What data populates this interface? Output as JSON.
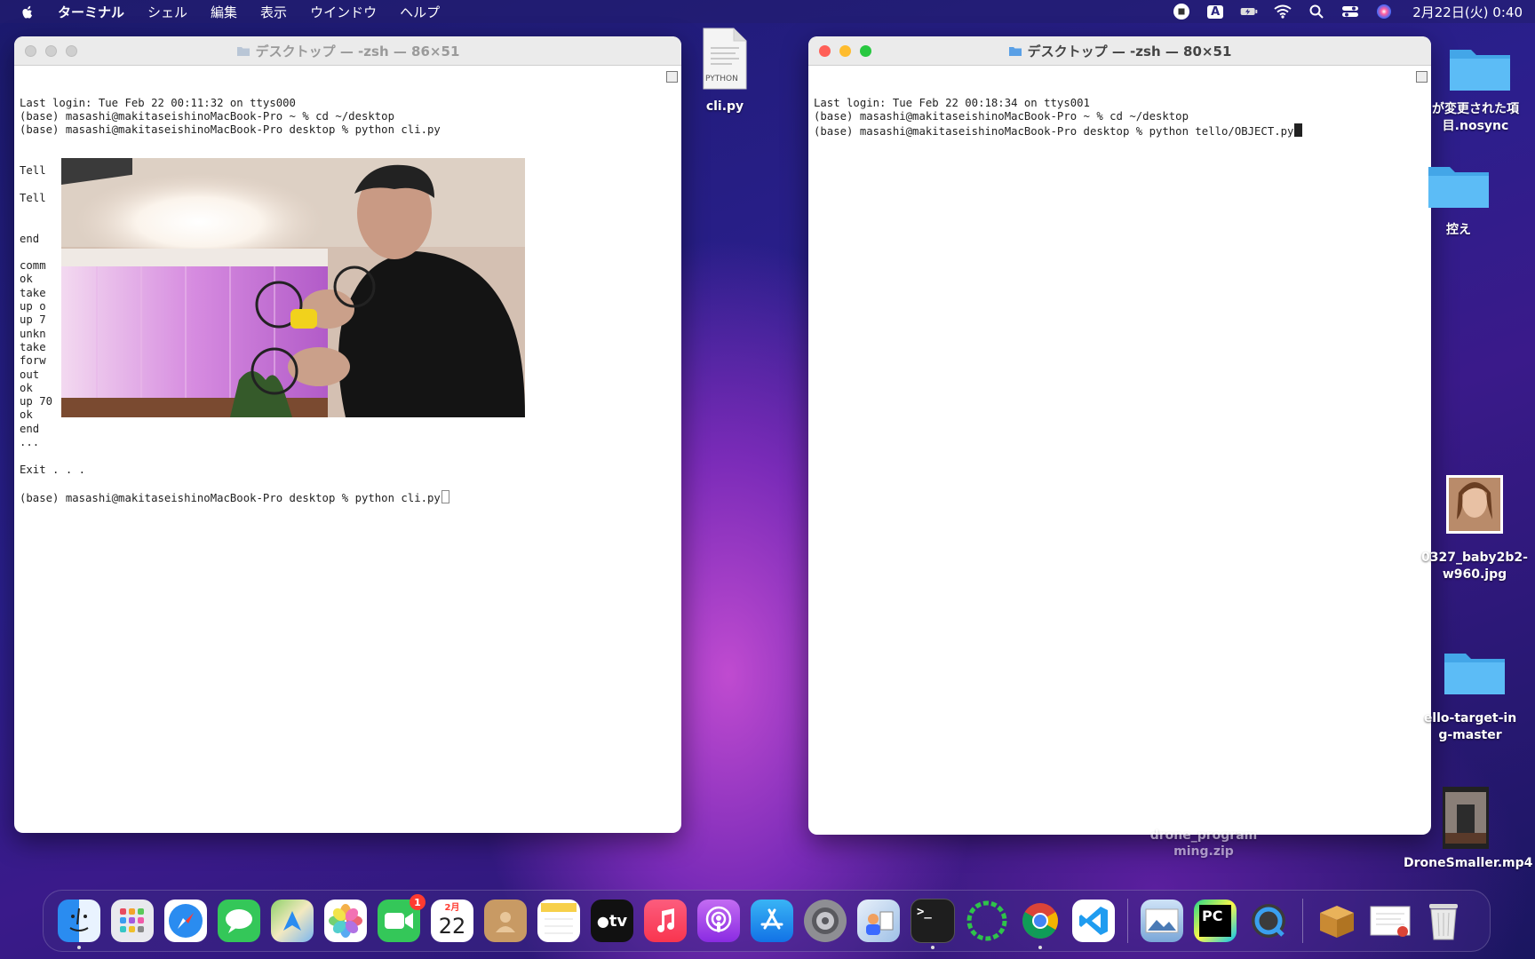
{
  "menubar": {
    "app_name": "ターミナル",
    "items": [
      "シェル",
      "編集",
      "表示",
      "ウインドウ",
      "ヘルプ"
    ],
    "input_mode": "A",
    "clock": "2月22日(火) 0:40"
  },
  "left_window": {
    "title": "デスクトップ — -zsh — 86×51",
    "lines": [
      "Last login: Tue Feb 22 00:11:32 on ttys000",
      "(base) masashi@makitaseishinoMacBook-Pro ~ % cd ~/desktop",
      "(base) masashi@makitaseishinoMacBook-Pro desktop % python cli.py",
      "",
      "",
      "Tell",
      "",
      "Tell",
      "",
      "",
      "end",
      "",
      "comm",
      "ok",
      "take",
      "up o",
      "up 7",
      "unkn",
      "take",
      "forw",
      "out",
      "ok",
      "up 70",
      "ok",
      "end",
      "...",
      "",
      "Exit . . .",
      "",
      "(base) masashi@makitaseishinoMacBook-Pro desktop % python cli.py"
    ]
  },
  "right_window": {
    "title": "デスクトップ — -zsh — 80×51",
    "lines": [
      "Last login: Tue Feb 22 00:18:34 on ttys001",
      "(base) masashi@makitaseishinoMacBook-Pro ~ % cd ~/desktop",
      "(base) masashi@makitaseishinoMacBook-Pro desktop % python tello/OBJECT.py"
    ]
  },
  "desktop_icons": {
    "cli_py": {
      "label": "cli.py",
      "badge": "PYTHON"
    },
    "nosync": {
      "label": "が変更された項目.nosync"
    },
    "hikae": {
      "label": "控え"
    },
    "baby_jpg": {
      "label": "0327_baby2b2-w960.jpg"
    },
    "tello_target": {
      "label": "ello-target-ing-master"
    },
    "drone_zip": {
      "label": "drone_programming.zip"
    },
    "drone_mp4": {
      "label": "DroneSmaller.mp4"
    }
  },
  "dock": {
    "calendar_month": "2月",
    "calendar_day": "22",
    "facetime_badge": "1",
    "tv_label": "tv",
    "pycharm_label": "PC"
  },
  "colors": {
    "accent_red": "#ff5f57",
    "accent_yellow": "#febc2e",
    "accent_green": "#28c840"
  }
}
